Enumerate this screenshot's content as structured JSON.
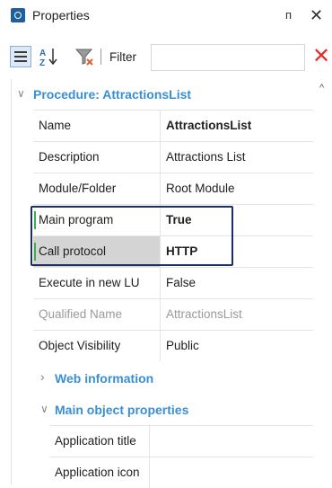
{
  "window": {
    "title": "Properties",
    "pin_glyph": "ᴨ",
    "close_glyph": "✕"
  },
  "toolbar": {
    "categorized_icon": "categorized-view-icon",
    "sort_icon": "sort-az-icon",
    "sort_glyph": "A↓Z",
    "filter_icon": "filter-icon",
    "filter_label": "Filter",
    "filter_value": "",
    "clear_glyph": "✕",
    "clear_color": "#e03030"
  },
  "categories": {
    "procedure": {
      "label": "Procedure: AttractionsList",
      "chevron": "∨"
    },
    "web_information": {
      "label": "Web information",
      "chevron": "›"
    },
    "main_object": {
      "label": "Main object properties",
      "chevron": "∨"
    }
  },
  "properties": [
    {
      "name": "Name",
      "value": "AttractionsList"
    },
    {
      "name": "Description",
      "value": "Attractions List"
    },
    {
      "name": "Module/Folder",
      "value": "Root Module"
    },
    {
      "name": "Main program",
      "value": "True"
    },
    {
      "name": "Call protocol",
      "value": "HTTP"
    },
    {
      "name": "Execute in new LU",
      "value": "False"
    },
    {
      "name": "Qualified Name",
      "value": "AttractionsList"
    },
    {
      "name": "Object Visibility",
      "value": "Public"
    }
  ],
  "main_object_properties": [
    {
      "name": "Application title",
      "value": ""
    },
    {
      "name": "Application icon",
      "value": ""
    }
  ],
  "scroll_glyph": "^",
  "colors": {
    "category_text": "#3a8fd4",
    "highlight_border": "#1c2e66",
    "modified_marker": "#3cae4a"
  }
}
